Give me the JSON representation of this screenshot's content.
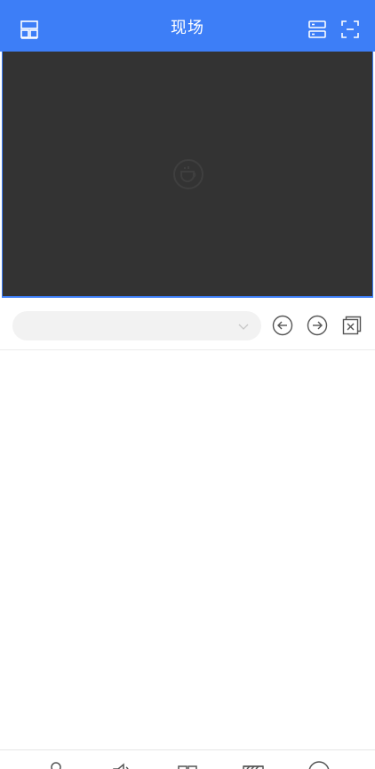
{
  "header": {
    "title": "现场",
    "left_icon": "layout-grid-icon",
    "right_icons": [
      "device-list-icon",
      "fullscreen-icon"
    ]
  },
  "video": {
    "placeholder_icon": "video-placeholder-icon"
  },
  "controls": {
    "channel_select": {
      "value": "",
      "options_icon": "chevron-down-icon"
    },
    "buttons": [
      "previous-arrow-icon",
      "next-arrow-icon",
      "close-all-icon"
    ]
  },
  "bottom_bar": {
    "icons": [
      "user-icon",
      "audio-icon",
      "split-view-icon",
      "record-icon",
      "more-icon"
    ]
  },
  "colors": {
    "accent": "#3d7ef7",
    "video_bg": "#333333",
    "control_icon": "#555555"
  }
}
